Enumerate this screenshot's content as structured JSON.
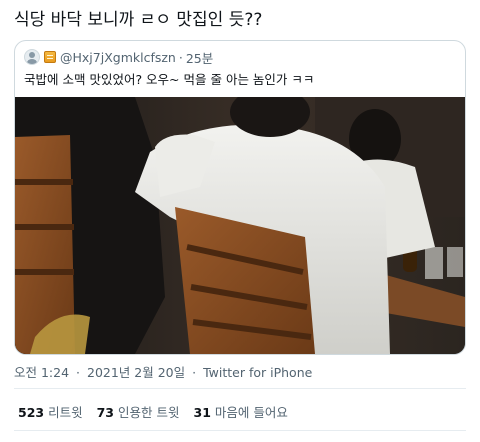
{
  "tweet": {
    "text": "식당 바닥 보니까 ㄹㅇ 맛집인 듯??"
  },
  "quote": {
    "handle": "@Hxj7jXgmklcfszn",
    "separator": "·",
    "time_ago": "25분",
    "text": "국밥에 소맥 맛있었어? 오우~ 먹을 줄 아는 놈인가 ㅋㅋ",
    "avatar_icon": "default-profile-icon",
    "badge_icon": "emoji-badge-icon"
  },
  "meta": {
    "time": "오전 1:24",
    "dot1": "·",
    "date": "2021년 2월 20일",
    "dot2": "·",
    "source": "Twitter for iPhone"
  },
  "stats": {
    "retweets_count": "523",
    "retweets_label": "리트윗",
    "quotes_count": "73",
    "quotes_label": "인용한 트윗",
    "likes_count": "31",
    "likes_label": "마음에 들어요"
  },
  "colors": {
    "text_primary": "#0f1419",
    "text_secondary": "#536471",
    "border": "#cfd9de"
  }
}
